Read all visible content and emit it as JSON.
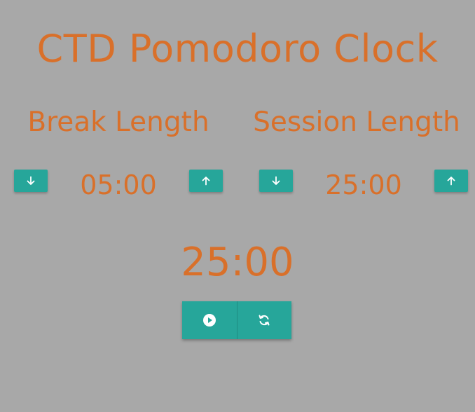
{
  "app": {
    "title": "CTD Pomodoro Clock"
  },
  "break": {
    "label": "Break Length",
    "value": "05:00",
    "decrement_icon": "arrow-down-icon",
    "increment_icon": "arrow-up-icon"
  },
  "session": {
    "label": "Session Length",
    "value": "25:00",
    "decrement_icon": "arrow-down-icon",
    "increment_icon": "arrow-up-icon"
  },
  "timer": {
    "display": "25:00"
  },
  "controls": {
    "play_icon": "play-circle-icon",
    "reset_icon": "refresh-icon"
  },
  "colors": {
    "background": "#a8a8a8",
    "text": "#d9702a",
    "button": "#26a69a"
  }
}
